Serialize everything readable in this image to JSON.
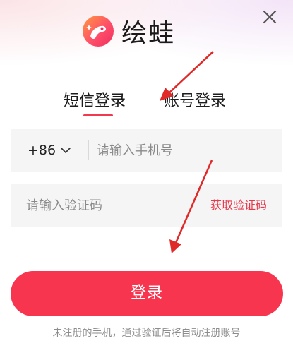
{
  "app": {
    "name": "绘蛙",
    "logo_icon": "frog-logo-icon",
    "brand_color": "#f7354f"
  },
  "close": {
    "icon": "close-icon",
    "symbol": "×"
  },
  "tabs": [
    {
      "label": "短信登录",
      "active": true
    },
    {
      "label": "账号登录",
      "active": false
    }
  ],
  "phone": {
    "country_code": "+86",
    "country_icon": "chevron-down-icon",
    "placeholder": "请输入手机号",
    "value": ""
  },
  "code": {
    "placeholder": "请输入验证码",
    "value": "",
    "get_code_label": "获取验证码"
  },
  "login_button": {
    "label": "登录"
  },
  "terms": {
    "text": "未注册的手机，通过验证后将自动注册账号"
  },
  "annotations": {
    "arrow_color": "#e02a2a"
  }
}
